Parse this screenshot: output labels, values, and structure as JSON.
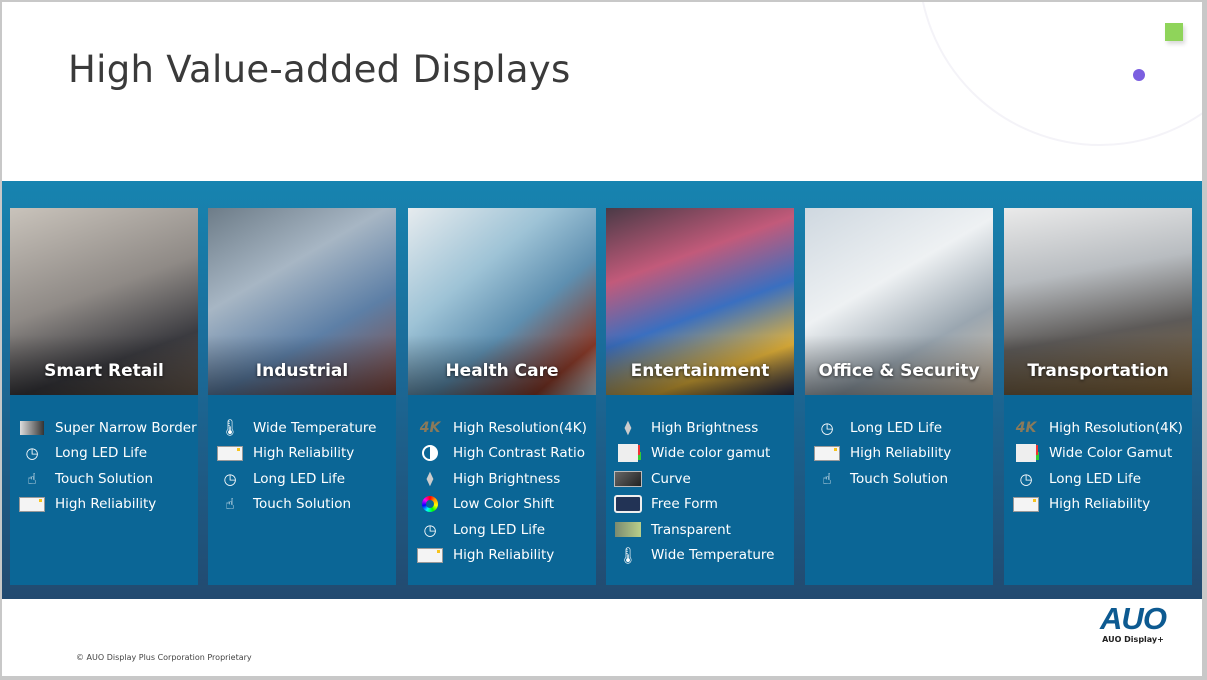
{
  "title": "High Value-added Displays",
  "footer": {
    "copyright": "© AUO Display Plus Corporation Proprietary",
    "logo": "AUO",
    "logo_sub": "AUO Display+"
  },
  "colors": {
    "band_top": "#1784b0",
    "band_bottom": "#224a70",
    "panel": "#0b6696",
    "accent_green": "#8fd45a",
    "accent_purple": "#7b5fe0",
    "logo": "#0d5a91"
  },
  "cards": [
    {
      "label": "Smart Retail",
      "image": "pos-terminal-photo",
      "features": [
        {
          "icon": "narrow-border-icon",
          "text": "Super Narrow Border"
        },
        {
          "icon": "clock-icon",
          "text": "Long LED Life"
        },
        {
          "icon": "touch-icon",
          "text": "Touch Solution"
        },
        {
          "icon": "reliability-icon",
          "text": "High Reliability"
        }
      ]
    },
    {
      "label": "Industrial",
      "image": "industrial-panel-photo",
      "features": [
        {
          "icon": "temperature-icon",
          "text": "Wide Temperature"
        },
        {
          "icon": "reliability-icon",
          "text": "High Reliability"
        },
        {
          "icon": "clock-icon",
          "text": "Long LED Life"
        },
        {
          "icon": "touch-icon",
          "text": "Touch Solution"
        }
      ]
    },
    {
      "label": "Health Care",
      "image": "surgeon-monitor-photo",
      "features": [
        {
          "icon": "4k-icon",
          "text": "High Resolution(4K)"
        },
        {
          "icon": "contrast-icon",
          "text": "High Contrast Ratio"
        },
        {
          "icon": "brightness-icon",
          "text": "High Brightness"
        },
        {
          "icon": "color-ring-icon",
          "text": "Low Color Shift"
        },
        {
          "icon": "clock-icon",
          "text": "Long LED Life"
        },
        {
          "icon": "reliability-icon",
          "text": "High Reliability"
        }
      ]
    },
    {
      "label": "Entertainment",
      "image": "pachinko-machines-photo",
      "features": [
        {
          "icon": "brightness-icon",
          "text": "High Brightness"
        },
        {
          "icon": "color-gamut-icon",
          "text": "Wide color gamut"
        },
        {
          "icon": "curved-tv-icon",
          "text": "Curve"
        },
        {
          "icon": "slot-machine-icon",
          "text": "Free Form"
        },
        {
          "icon": "transparent-icon",
          "text": "Transparent"
        },
        {
          "icon": "temperature-icon",
          "text": "Wide Temperature"
        }
      ]
    },
    {
      "label": "Office & Security",
      "image": "office-printer-photo",
      "features": [
        {
          "icon": "clock-icon",
          "text": "Long LED Life"
        },
        {
          "icon": "reliability-icon",
          "text": "High Reliability"
        },
        {
          "icon": "touch-icon",
          "text": "Touch Solution"
        }
      ]
    },
    {
      "label": "Transportation",
      "image": "airplane-seatback-photo",
      "features": [
        {
          "icon": "4k-icon",
          "text": "High Resolution(4K)"
        },
        {
          "icon": "color-gamut-icon",
          "text": "Wide Color Gamut"
        },
        {
          "icon": "clock-icon",
          "text": "Long LED Life"
        },
        {
          "icon": "reliability-icon",
          "text": "High Reliability"
        }
      ]
    }
  ]
}
